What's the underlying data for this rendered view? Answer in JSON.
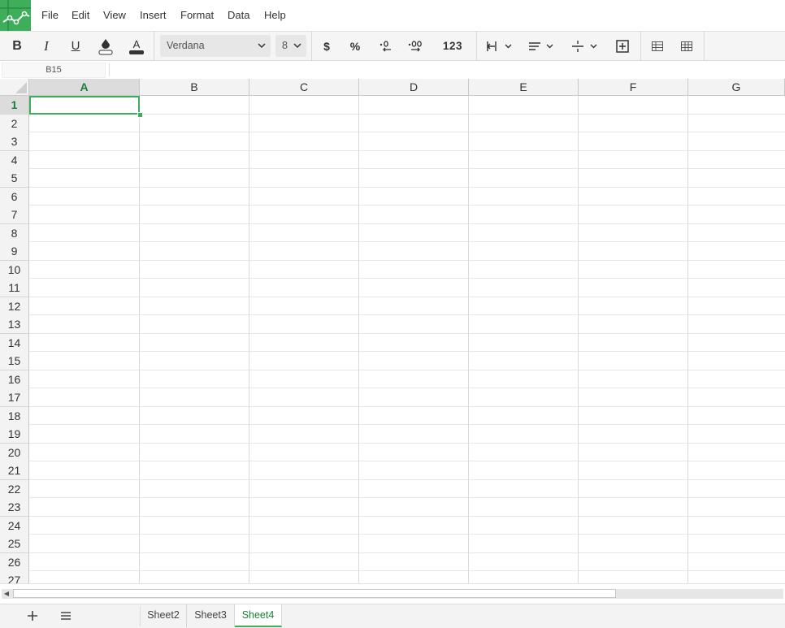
{
  "menu": {
    "items": [
      "File",
      "Edit",
      "View",
      "Insert",
      "Format",
      "Data",
      "Help"
    ]
  },
  "toolbar": {
    "font_name": "Verdana",
    "font_size": "8",
    "currency_label": "$",
    "percent_label": "%",
    "number_format_label": "123"
  },
  "formula_bar": {
    "cell_ref": "B15",
    "formula": ""
  },
  "sheet": {
    "columns": [
      "A",
      "B",
      "C",
      "D",
      "E",
      "F",
      "G"
    ],
    "rows": [
      "1",
      "2",
      "3",
      "4",
      "5",
      "6",
      "7",
      "8",
      "9",
      "10",
      "11",
      "12",
      "13",
      "14",
      "15",
      "16",
      "17",
      "18",
      "19",
      "20",
      "21",
      "22",
      "23",
      "24",
      "25",
      "26",
      "27"
    ],
    "active_column": "A",
    "active_row": "1"
  },
  "tabs": {
    "items": [
      "Sheet2",
      "Sheet3",
      "Sheet4"
    ],
    "active": "Sheet4"
  },
  "colors": {
    "accent": "#3fae5a",
    "active_text": "#188038"
  }
}
